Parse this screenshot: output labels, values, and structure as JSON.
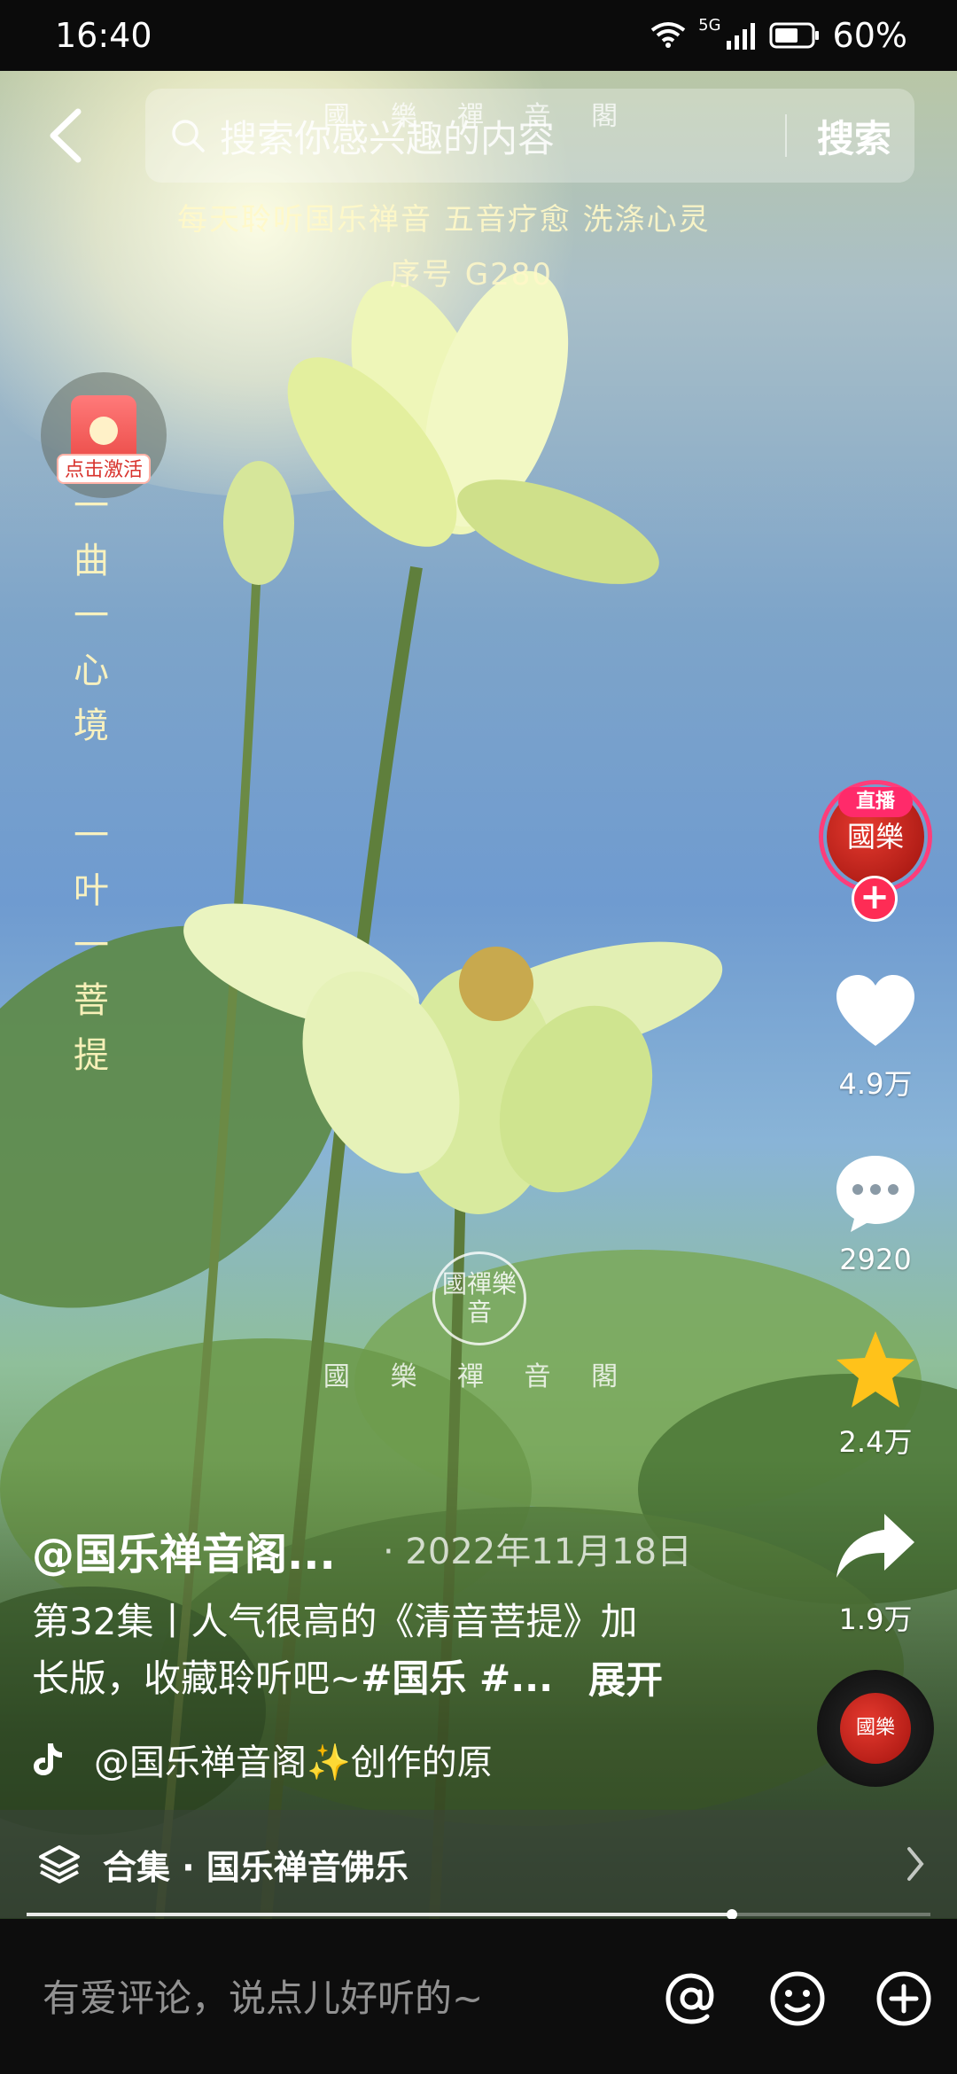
{
  "status_bar": {
    "time": "16:40",
    "network": "5G",
    "battery": "60%"
  },
  "watermarks": {
    "top": "國 樂 禪 音 閣",
    "line1": "每天聆听国乐禅音 五音疗愈 洗涤心灵",
    "line2": "序号 G280",
    "vertical": [
      "一",
      "曲",
      "一",
      "心",
      "境",
      "",
      "一",
      "叶",
      "一",
      "菩",
      "提"
    ],
    "seal": "國禪樂音",
    "bottom": "國 樂 禪 音 閣"
  },
  "search": {
    "placeholder": "搜索你感兴趣的内容",
    "button": "搜索"
  },
  "activate": {
    "label": "点击激活"
  },
  "creator": {
    "avatar_text": "國樂",
    "live_badge": "直播",
    "follow": "+"
  },
  "actions": {
    "likes": "4.9万",
    "comments": "2920",
    "favorites": "2.4万",
    "shares": "1.9万"
  },
  "post": {
    "author": "@国乐禅音阁...",
    "date": "· 2022年11月18日",
    "caption_text": "第32集丨人气很高的《清音菩提》加长版，收藏聆听吧~",
    "caption_tags": "#国乐 #...",
    "expand": "展开",
    "music": "@国乐禅音阁✨创作的原",
    "disc_text": "國樂"
  },
  "collection": {
    "label": "合集 · 国乐禅音佛乐"
  },
  "progress": {
    "fraction": 0.78
  },
  "comment_bar": {
    "placeholder": "有爱评论，说点儿好听的~"
  },
  "colors": {
    "accent_pink": "#fe2c55",
    "live_ring": "#ff3d7a",
    "star": "#ffc21a"
  }
}
